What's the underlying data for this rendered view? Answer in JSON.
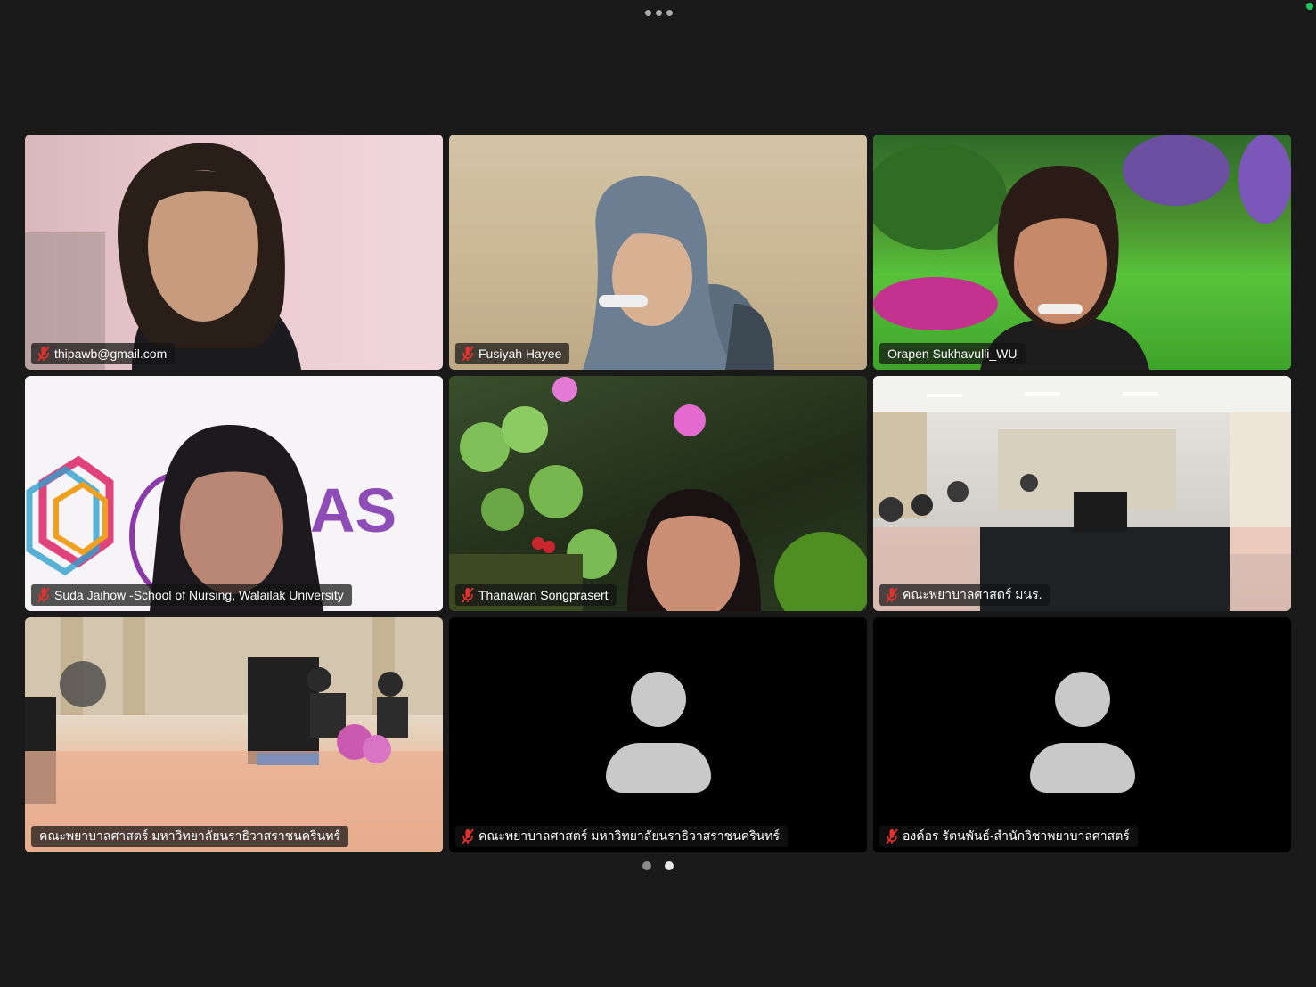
{
  "window": {
    "more_options_icon": "ellipsis-icon",
    "status_color": "#22c55e"
  },
  "participants": [
    {
      "name": "thipawb@gmail.com",
      "muted": true,
      "video": "on"
    },
    {
      "name": "Fusiyah Hayee",
      "muted": true,
      "video": "on"
    },
    {
      "name": "Orapen Sukhavulli_WU",
      "muted": false,
      "video": "on",
      "active_speaker": true
    },
    {
      "name": "Suda Jaihow -School of Nursing, Walailak University",
      "muted": true,
      "video": "on"
    },
    {
      "name": "Thanawan Songprasert",
      "muted": true,
      "video": "on"
    },
    {
      "name": "คณะพยาบาลศาสตร์ มนร.",
      "muted": true,
      "video": "on"
    },
    {
      "name": "คณะพยาบาลศาสตร์ มหาวิทยาลัยนราธิวาสราชนครินทร์",
      "muted": false,
      "video": "on"
    },
    {
      "name": "คณะพยาบาลศาสตร์ มหาวิทยาลัยนราธิวาสราชนครินทร์",
      "muted": true,
      "video": "off"
    },
    {
      "name": "องค์อร รัตนพันธ์-สำนักวิชาพยาบาลศาสตร์",
      "muted": true,
      "video": "off"
    }
  ],
  "colors": {
    "active_speaker_border": "#2dd24f",
    "muted_icon": "#e5322d",
    "background": "#1a1a1a"
  },
  "pagination": {
    "pages": 2,
    "current": 2
  }
}
